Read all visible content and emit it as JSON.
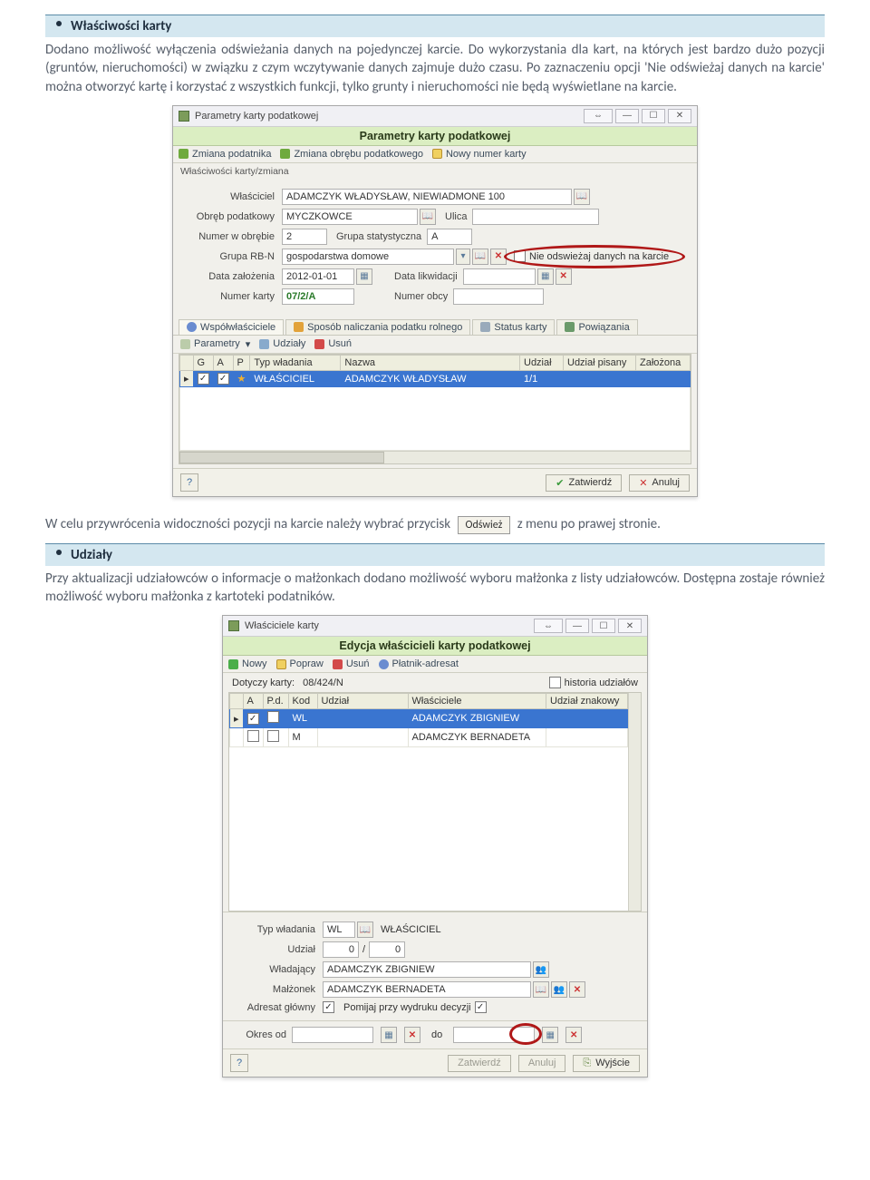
{
  "sections": {
    "s1_title": "Właściwości karty",
    "s1_body": "Dodano możliwość wyłączenia odświeżania danych na pojedynczej karcie. Do wykorzystania dla kart, na których jest bardzo dużo pozycji (gruntów, nieruchomości) w związku z czym wczytywanie danych zajmuje dużo czasu. Po zaznaczeniu opcji 'Nie odświeżaj danych na karcie' można otworzyć kartę i korzystać z wszystkich funkcji, tylko grunty i nieruchomości nie będą wyświetlane na karcie.",
    "s2_pre": "W celu przywrócenia widoczności pozycji na karcie należy wybrać przycisk",
    "s2_btn": "Odśwież",
    "s2_post": "z menu po prawej stronie.",
    "s3_title": "Udziały",
    "s3_body": "Przy aktualizacji udziałowców o informacje o małżonkach dodano możliwość wyboru małżonka z listy udziałowców. Dostępna zostaje również możliwość wyboru małżonka z kartoteki podatników."
  },
  "win1": {
    "win_caption": "Parametry karty podatkowej",
    "green_title": "Parametry karty podatkowej",
    "toolbar": {
      "t1": "Zmiana podatnika",
      "t2": "Zmiana obrębu podatkowego",
      "t3": "Nowy numer karty"
    },
    "section_label": "Właściwości karty/zmiana",
    "labels": {
      "wlasciciel": "Właściciel",
      "obreb": "Obręb podatkowy",
      "ulica": "Ulica",
      "numer_w_obrebie": "Numer w obrębie",
      "grupa_stat": "Grupa statystyczna",
      "grupa_rbn": "Grupa RB-N",
      "data_zal": "Data założenia",
      "data_likw": "Data likwidacji",
      "numer_karty": "Numer karty",
      "numer_obcy": "Numer obcy",
      "nie_odswiezaj": "Nie odswieżaj danych na karcie"
    },
    "values": {
      "wlasciciel": "ADAMCZYK WŁADYSŁAW, NIEWIADMONE 100",
      "obreb": "MYCZKOWCE",
      "ulica": "",
      "numer_w_obrebie": "2",
      "grupa_stat": "A",
      "grupa_rbn": "gospodarstwa domowe",
      "data_zal": "2012-01-01",
      "data_likw": "",
      "numer_karty": "07/2/A",
      "numer_obcy": ""
    },
    "tabs": {
      "t1": "Współwłaściciele",
      "t2": "Sposób naliczania podatku rolnego",
      "t3": "Status karty",
      "t4": "Powiązania"
    },
    "subtoolbar": {
      "parametry": "Parametry",
      "udzialy": "Udziały",
      "usun": "Usuń"
    },
    "grid": {
      "headers": {
        "g": "G",
        "a": "A",
        "p": "P",
        "typ": "Typ władania",
        "nazwa": "Nazwa",
        "udzial": "Udział",
        "udzial_pis": "Udział pisany",
        "zalozona": "Założona"
      },
      "row": {
        "typ": "WŁAŚCICIEL",
        "nazwa": "ADAMCZYK WŁADYSŁAW",
        "udzial": "1/1"
      }
    },
    "footer": {
      "zatwierdz": "Zatwierdź",
      "anuluj": "Anuluj"
    }
  },
  "win2": {
    "win_caption": "Właściciele karty",
    "green_title": "Edycja właścicieli karty podatkowej",
    "toolbar": {
      "nowy": "Nowy",
      "popraw": "Popraw",
      "usun": "Usuń",
      "platnik": "Płatnik-adresat"
    },
    "dotyczy_label": "Dotyczy karty:",
    "dotyczy_value": "08/424/N",
    "historia": "historia udziałów",
    "grid": {
      "headers": {
        "a": "A",
        "pd": "P.d.",
        "kod": "Kod",
        "udzial": "Udział",
        "wlasciciele": "Właściciele",
        "udzial_zn": "Udział znakowy"
      },
      "rows": [
        {
          "kod": "WL",
          "wlasciciele": "ADAMCZYK ZBIGNIEW"
        },
        {
          "kod": "M",
          "wlasciciele": "ADAMCZYK BERNADETA"
        }
      ]
    },
    "bottom": {
      "typ_wladania_label": "Typ władania",
      "typ_wladania_code": "WL",
      "typ_wladania_text": "WŁAŚCICIEL",
      "udzial_label": "Udział",
      "udzial_a": "0",
      "udzial_sep": "/",
      "udzial_b": "0",
      "wladajacy_label": "Władający",
      "wladajacy": "ADAMCZYK ZBIGNIEW",
      "malzonek_label": "Małżonek",
      "malzonek": "ADAMCZYK BERNADETA",
      "adresat_label": "Adresat główny",
      "pomin_label": "Pomijaj przy wydruku decyzji",
      "okres_od": "Okres od",
      "do": "do"
    },
    "footer": {
      "zatwierdz": "Zatwierdź",
      "anuluj": "Anuluj",
      "wyjscie": "Wyjście"
    }
  }
}
